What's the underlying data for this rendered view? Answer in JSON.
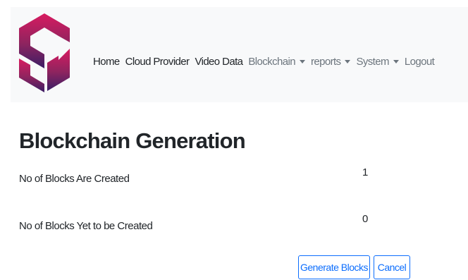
{
  "navbar": {
    "logo_icon": "brand-logo-hexagon",
    "items": [
      {
        "label": "Home",
        "dropdown": false
      },
      {
        "label": "Cloud Provider",
        "dropdown": false
      },
      {
        "label": "Video Data",
        "dropdown": false
      },
      {
        "label": "Blockchain",
        "dropdown": true
      },
      {
        "label": "reports",
        "dropdown": true
      },
      {
        "label": "System",
        "dropdown": true
      },
      {
        "label": "Logout",
        "dropdown": false
      }
    ]
  },
  "main": {
    "title": "Blockchain Generation",
    "rows": [
      {
        "label": "No of Blocks Are Created",
        "value": "1"
      },
      {
        "label": "No of Blocks Yet to be Created",
        "value": "0"
      }
    ],
    "buttons": {
      "generate": "Generate Blocks",
      "cancel": "Cancel"
    }
  },
  "colors": {
    "navbar_bg": "#f8f9fa",
    "primary": "#0d6efd",
    "logo_top": "#c2185b",
    "logo_bottom": "#4a1f6e"
  }
}
